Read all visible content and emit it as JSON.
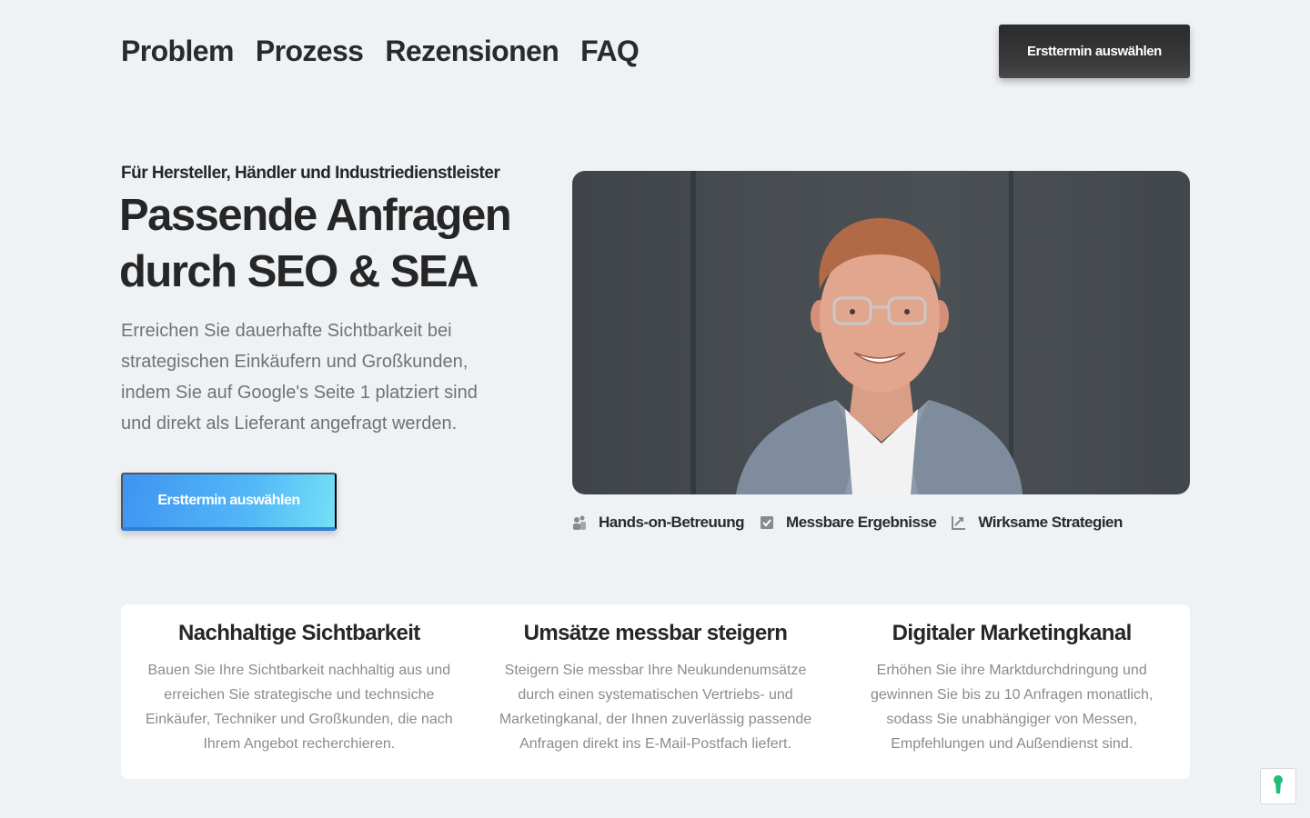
{
  "nav": {
    "items": [
      {
        "label": "Problem"
      },
      {
        "label": "Prozess"
      },
      {
        "label": "Rezensionen"
      },
      {
        "label": "FAQ"
      }
    ],
    "cta_label": "Ersttermin auswählen"
  },
  "hero": {
    "eyebrow": "Für Hersteller, Händler und Industriedienstleister",
    "headline": "Passende Anfragen durch SEO & SEA",
    "lead": "Erreichen Sie dauerhafte Sichtbarkeit bei strategischen Einkäufern und Großkunden, indem Sie auf Google's Seite 1 platziert sind und direkt als Lieferant angefragt werden.",
    "cta_label": "Ersttermin auswählen"
  },
  "features": [
    {
      "icon": "people-icon",
      "label": "Hands-on-Betreuung"
    },
    {
      "icon": "checkbox-icon",
      "label": "Messbare Ergebnisse"
    },
    {
      "icon": "trend-up-icon",
      "label": "Wirksame Strategien"
    }
  ],
  "cards": [
    {
      "title": "Nachhaltige Sichtbarkeit",
      "text": "Bauen Sie Ihre Sichtbarkeit nachhaltig aus und erreichen Sie strategische und technsiche Einkäufer, Techniker und Großkunden, die nach Ihrem Angebot recherchieren."
    },
    {
      "title": "Umsätze messbar steigern",
      "text": "Steigern Sie messbar Ihre Neukundenumsätze durch einen systematischen Vertriebs- und Marketingkanal, der Ihnen zuverlässig passende Anfragen direkt ins E-Mail-Postfach liefert."
    },
    {
      "title": "Digitaler Marketingkanal",
      "text": "Erhöhen Sie ihre Marktdurchdringung und gewinnen Sie bis zu 10 Anfragen monatlich, sodass Sie unabhängiger von Messen, Empfehlungen und Außendienst sind."
    }
  ],
  "colors": {
    "background": "#eff2f5",
    "primary_cta": "#3f94f2",
    "dark_cta": "#2b2b2b"
  }
}
